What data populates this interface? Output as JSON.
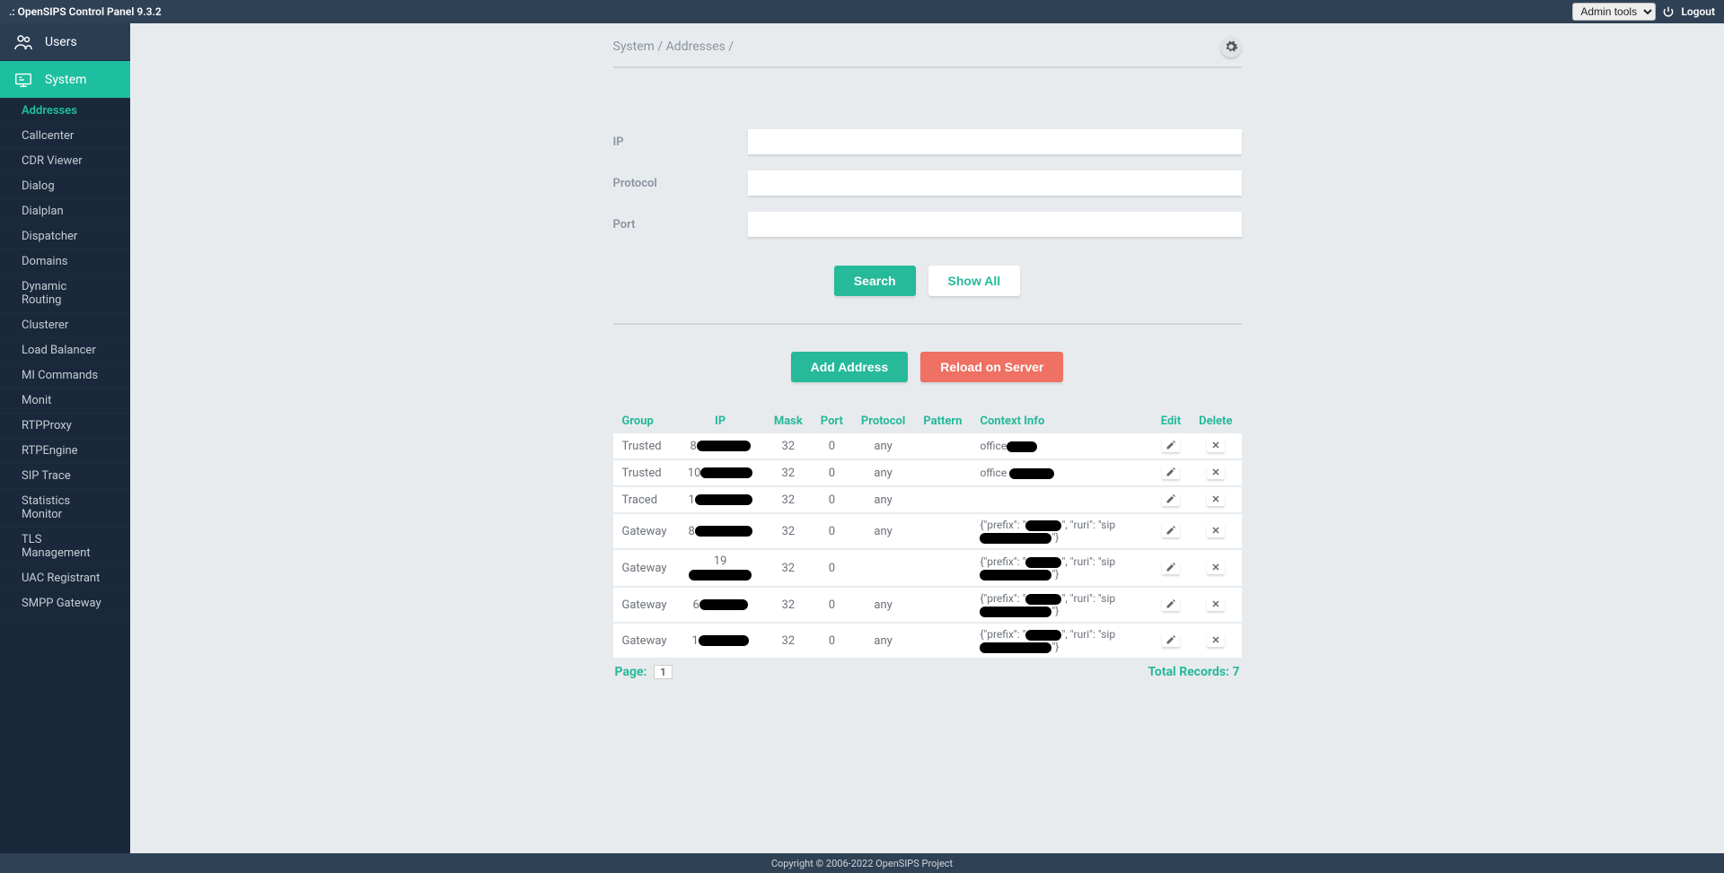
{
  "topbar": {
    "title": ".: OpenSIPS Control Panel 9.3.2",
    "admin_tools": "Admin tools",
    "logout": "Logout"
  },
  "sidebar": {
    "users_label": "Users",
    "system_label": "System",
    "items": [
      "Addresses",
      "Callcenter",
      "CDR Viewer",
      "Dialog",
      "Dialplan",
      "Dispatcher",
      "Domains",
      "Dynamic Routing",
      "Clusterer",
      "Load Balancer",
      "MI Commands",
      "Monit",
      "RTPProxy",
      "RTPEngine",
      "SIP Trace",
      "Statistics Monitor",
      "TLS Management",
      "UAC Registrant",
      "SMPP Gateway"
    ]
  },
  "breadcrumb": "System / Addresses /",
  "form": {
    "ip_label": "IP",
    "protocol_label": "Protocol",
    "port_label": "Port",
    "search": "Search",
    "show_all": "Show All"
  },
  "actions": {
    "add": "Add Address",
    "reload": "Reload on Server"
  },
  "table": {
    "headers": {
      "group": "Group",
      "ip": "IP",
      "mask": "Mask",
      "port": "Port",
      "protocol": "Protocol",
      "pattern": "Pattern",
      "context": "Context Info",
      "edit": "Edit",
      "delete": "Delete"
    },
    "rows": [
      {
        "group": "Trusted",
        "ip_prefix": "8",
        "mask": "32",
        "port": "0",
        "protocol": "any",
        "context_prefix": "office",
        "context_json": false,
        "redact_w": [
          60,
          34
        ]
      },
      {
        "group": "Trusted",
        "ip_prefix": "10",
        "mask": "32",
        "port": "0",
        "protocol": "any",
        "context_prefix": "office ",
        "context_json": false,
        "redact_w": [
          58,
          50
        ]
      },
      {
        "group": "Traced",
        "ip_prefix": "1",
        "mask": "32",
        "port": "0",
        "protocol": "any",
        "context_prefix": "",
        "context_json": false,
        "redact_w": [
          64,
          0
        ]
      },
      {
        "group": "Gateway",
        "ip_prefix": "8",
        "mask": "32",
        "port": "0",
        "protocol": "any",
        "context_prefix": "",
        "context_json": true,
        "redact_w": [
          64,
          0
        ]
      },
      {
        "group": "Gateway",
        "ip_prefix": "19",
        "mask": "32",
        "port": "0",
        "protocol": "",
        "context_prefix": "",
        "context_json": true,
        "redact_w": [
          70,
          0
        ]
      },
      {
        "group": "Gateway",
        "ip_prefix": "6",
        "mask": "32",
        "port": "0",
        "protocol": "any",
        "context_prefix": "",
        "context_json": true,
        "redact_w": [
          54,
          0
        ]
      },
      {
        "group": "Gateway",
        "ip_prefix": "1",
        "mask": "32",
        "port": "0",
        "protocol": "any",
        "context_prefix": "",
        "context_json": true,
        "redact_w": [
          56,
          0
        ]
      }
    ],
    "json_tpl": {
      "prefix_label": "{\"prefix\": \"",
      "ruri_label": "\", \"ruri\": \"sip",
      "close": "\"}"
    }
  },
  "pagination": {
    "page_label": "Page:",
    "page": "1",
    "total_label": "Total Records: 7"
  },
  "footer": "Copyright © 2006-2022 OpenSIPS Project"
}
